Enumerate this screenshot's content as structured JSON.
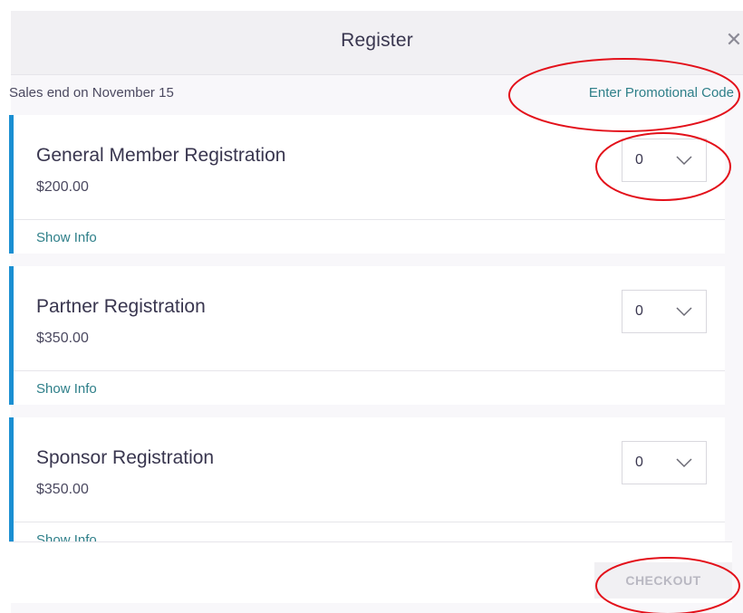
{
  "modal": {
    "title": "Register",
    "close_icon": "close-icon",
    "sales_end": "Sales end on November 15",
    "promo_link": "Enter Promotional Code"
  },
  "tickets": [
    {
      "name": "General Member Registration",
      "price": "$200.00",
      "quantity": "0",
      "show_info": "Show Info"
    },
    {
      "name": "Partner Registration",
      "price": "$350.00",
      "quantity": "0",
      "show_info": "Show Info"
    },
    {
      "name": "Sponsor Registration",
      "price": "$350.00",
      "quantity": "0",
      "show_info": "Show Info"
    }
  ],
  "footer": {
    "checkout_label": "CHECKOUT"
  },
  "colors": {
    "accent_blue": "#1a8fd2",
    "link_teal": "#2e7f89",
    "annotation_red": "#e3101a",
    "disabled_text": "#b9b8c2"
  }
}
